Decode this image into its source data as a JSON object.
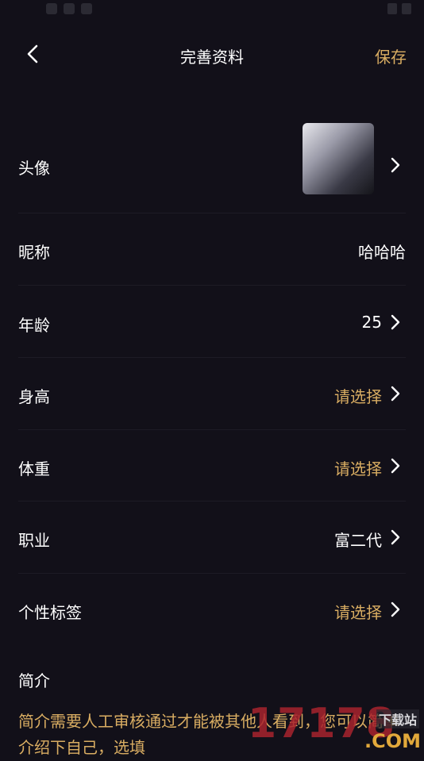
{
  "header": {
    "title": "完善资料",
    "save_label": "保存"
  },
  "form": {
    "avatar_label": "头像",
    "nickname_label": "昵称",
    "nickname_value": "哈哈哈",
    "age_label": "年龄",
    "age_value": "25",
    "height_label": "身高",
    "height_value": "请选择",
    "weight_label": "体重",
    "weight_value": "请选择",
    "job_label": "职业",
    "job_value": "富二代",
    "tags_label": "个性标签",
    "tags_value": "请选择"
  },
  "intro": {
    "label": "简介",
    "text": "简介需要人工审核通过才能被其他人看到，您可以简单介绍下自己，选填"
  },
  "watermark": {
    "num": "17178",
    "dl": "下载站",
    "com": ".COM"
  },
  "colors": {
    "background": "#121019",
    "accent": "#d9ad62",
    "text": "#ffffff"
  }
}
